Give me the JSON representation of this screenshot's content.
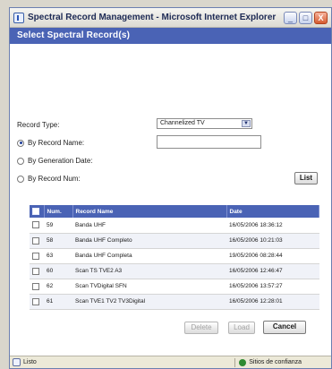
{
  "window": {
    "title": "Spectral Record Management - Microsoft Internet Explorer",
    "min_glyph": "_",
    "max_glyph": "□",
    "close_glyph": "X"
  },
  "dialog": {
    "heading": "Select Spectral Record(s)"
  },
  "form": {
    "record_type_label": "Record Type:",
    "record_type_value": "Channelized TV",
    "radio_by_name": "By Record Name:",
    "radio_by_date": "By Generation Date:",
    "radio_by_num": "By Record Num:",
    "selected_radio": "by_name",
    "record_name_value": "",
    "list_button": "List"
  },
  "table": {
    "columns": [
      "",
      "Num.",
      "Record Name",
      "Date"
    ],
    "rows": [
      {
        "num": "59",
        "name": "Banda UHF",
        "date": "16/05/2006 18:36:12"
      },
      {
        "num": "58",
        "name": "Banda UHF Completo",
        "date": "16/05/2006 10:21:03"
      },
      {
        "num": "63",
        "name": "Banda UHF Completa",
        "date": "19/05/2006 08:28:44"
      },
      {
        "num": "60",
        "name": "Scan TS TVE2 A3",
        "date": "16/05/2006 12:46:47"
      },
      {
        "num": "62",
        "name": "Scan TVDigital SFN",
        "date": "16/05/2006 13:57:27"
      },
      {
        "num": "61",
        "name": "Scan TVE1 TV2 TV3Digital",
        "date": "16/05/2006 12:28:01"
      }
    ]
  },
  "buttons": {
    "delete": "Delete",
    "load": "Load",
    "cancel": "Cancel"
  },
  "statusbar": {
    "left": "Listo",
    "zone": "Sitios de confianza"
  }
}
